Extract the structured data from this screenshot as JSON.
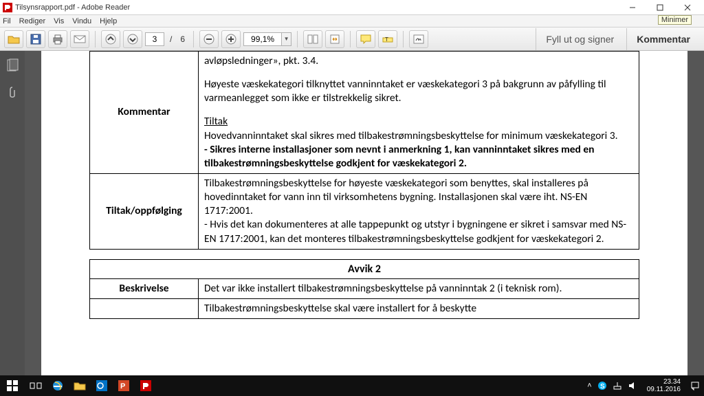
{
  "window": {
    "title": "Tilsynsrapport.pdf - Adobe Reader",
    "minimer": "Minimer"
  },
  "menu": {
    "file": "Fil",
    "edit": "Rediger",
    "view": "Vis",
    "window": "Vindu",
    "help": "Hjelp"
  },
  "toolbar": {
    "page_current": "3",
    "page_sep": "/",
    "page_total": "6",
    "zoom": "99,1%",
    "fill_sign": "Fyll ut og signer",
    "comment": "Kommentar"
  },
  "doc": {
    "row1_label": "Kommentar",
    "row1_p1": "avløpsledninger», pkt. 3.4.",
    "row1_p2": "Høyeste væskekategori tilknyttet vanninntaket er væskekategori 3 på bakgrunn av påfylling til varmeanlegget som ikke er tilstrekkelig sikret.",
    "row1_tiltak_h": "Tiltak",
    "row1_p3": "Hovedvanninntaket skal sikres med tilbakestrømningsbeskyttelse for minimum væskekategori 3.",
    "row1_p4": "- Sikres interne installasjoner som nevnt i anmerkning 1, kan vanninntaket sikres med en tilbakestrømningsbeskyttelse godkjent for væskekategori 2.",
    "row2_label": "Tiltak/oppfølging",
    "row2_body": "Tilbakestrømningsbeskyttelse for høyeste væskekategori som benyttes, skal installeres på hovedinntaket for vann inn til virksomhetens bygning. Installasjonen skal være iht. NS-EN 1717:2001.\n- Hvis det kan dokumenteres at alle tappepunkt og utstyr i bygningene er sikret i samsvar med NS-EN 1717:2001, kan det monteres tilbakestrømningsbeskyttelse godkjent for væskekategori 2.",
    "avvik2_header": "Avvik 2",
    "row3_label": "Beskrivelse",
    "row3_body": "Det var ikke installert tilbakestrømningsbeskyttelse på vanninntak 2 (i teknisk rom).",
    "row4_body_partial": "Tilbakestrømningsbeskyttelse skal være installert for å beskytte"
  },
  "tray": {
    "time": "23.34",
    "date": "09.11.2016"
  }
}
